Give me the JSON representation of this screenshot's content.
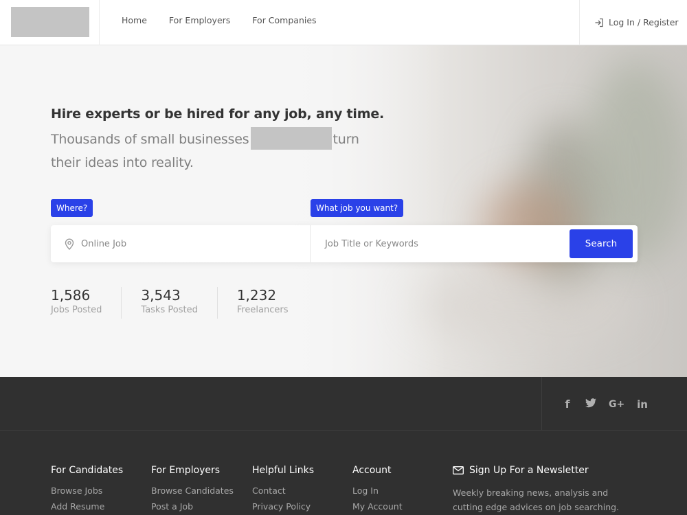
{
  "header": {
    "nav": [
      "Home",
      "For Employers",
      "For Companies"
    ],
    "login_label": "Log In / Register"
  },
  "hero": {
    "headline": "Hire experts or be hired for any job, any time.",
    "subline_start": "Thousands of small businesses",
    "subline_end": "turn their ideas into reality.",
    "where_tag": "Where?",
    "what_tag": "What job you want?",
    "location_value": "Online Job",
    "keyword_placeholder": "Job Title or Keywords",
    "search_label": "Search",
    "stats": [
      {
        "number": "1,586",
        "label": "Jobs Posted"
      },
      {
        "number": "3,543",
        "label": "Tasks Posted"
      },
      {
        "number": "1,232",
        "label": "Freelancers"
      }
    ]
  },
  "footer": {
    "social": [
      {
        "icon": "facebook-icon",
        "glyph": "f"
      },
      {
        "icon": "twitter-icon",
        "glyph": "t"
      },
      {
        "icon": "google-plus-icon",
        "glyph": "G+"
      },
      {
        "icon": "linkedin-icon",
        "glyph": "in"
      }
    ],
    "columns": [
      {
        "title": "For Candidates",
        "links": [
          "Browse Jobs",
          "Add Resume"
        ]
      },
      {
        "title": "For Employers",
        "links": [
          "Browse Candidates",
          "Post a Job"
        ]
      },
      {
        "title": "Helpful Links",
        "links": [
          "Contact",
          "Privacy Policy"
        ]
      },
      {
        "title": "Account",
        "links": [
          "Log In",
          "My Account"
        ]
      }
    ],
    "newsletter": {
      "title": "Sign Up For a Newsletter",
      "text": "Weekly breaking news, analysis and cutting edge advices on job searching."
    }
  },
  "colors": {
    "accent": "#2a41e8",
    "footer_bg": "#303030"
  }
}
